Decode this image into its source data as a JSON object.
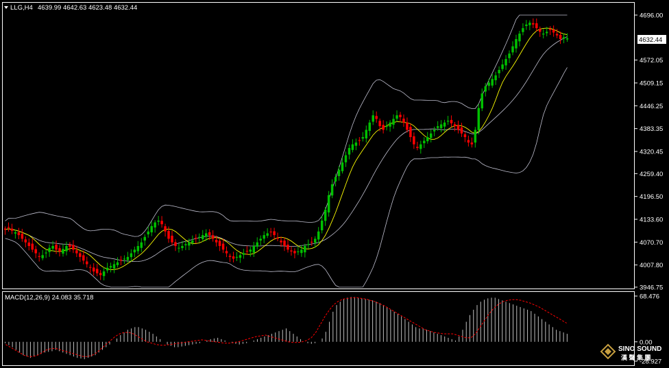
{
  "window": {
    "symbol_line": "LLG,H4",
    "ohlc_line": "4639.99 4642.63 4623.48 4632.44"
  },
  "indicator": {
    "macd_line": "MACD(12,26,9) 24.083 35.718"
  },
  "current_price_label": "4632.44",
  "watermark": {
    "brand": "SINO SOUND",
    "cjk": "漢 聲 集 團"
  },
  "colors": {
    "background": "#000000",
    "bull": "#00c000",
    "bear": "#ff0000",
    "band": "#c0c0d0",
    "ma": "#ffff00",
    "macd_hist": "#c0c0c0",
    "macd_signal": "#ff0000",
    "axis": "#ffffff",
    "gold": "#c8a040"
  },
  "chart_data": [
    {
      "type": "candlestick",
      "name_printed": "LLG,H4",
      "y_ticks": [
        "4696.00",
        "4632.44",
        "4572.05",
        "4509.15",
        "4446.25",
        "4383.35",
        "4320.45",
        "4259.40",
        "4196.50",
        "4133.60",
        "4070.70",
        "4007.80",
        "3946.75"
      ],
      "ylim": [
        3946.75,
        4696.0
      ],
      "overlays": [
        "bollinger-upper",
        "bollinger-middle",
        "bollinger-lower",
        "moving-average"
      ],
      "closes": [
        4105,
        4110,
        4102,
        4098,
        4090,
        4080,
        4070,
        4060,
        4050,
        4040,
        4030,
        4035,
        4042,
        4055,
        4060,
        4050,
        4045,
        4052,
        4060,
        4058,
        4050,
        4040,
        4030,
        4020,
        4010,
        4000,
        3990,
        3985,
        3980,
        3990,
        4000,
        4005,
        4010,
        4015,
        4020,
        4025,
        4030,
        4040,
        4050,
        4060,
        4070,
        4085,
        4100,
        4115,
        4125,
        4130,
        4120,
        4100,
        4080,
        4070,
        4060,
        4055,
        4060,
        4065,
        4070,
        4075,
        4080,
        4085,
        4090,
        4095,
        4090,
        4080,
        4070,
        4060,
        4050,
        4040,
        4030,
        4025,
        4030,
        4035,
        4040,
        4045,
        4050,
        4060,
        4070,
        4080,
        4090,
        4095,
        4098,
        4090,
        4080,
        4070,
        4060,
        4050,
        4045,
        4040,
        4045,
        4050,
        4060,
        4065,
        4070,
        4080,
        4100,
        4130,
        4160,
        4200,
        4230,
        4250,
        4270,
        4290,
        4310,
        4330,
        4340,
        4345,
        4350,
        4360,
        4380,
        4400,
        4420,
        4410,
        4390,
        4380,
        4390,
        4400,
        4410,
        4420,
        4415,
        4400,
        4380,
        4360,
        4340,
        4330,
        4340,
        4350,
        4360,
        4370,
        4380,
        4390,
        4395,
        4400,
        4405,
        4398,
        4390,
        4380,
        4370,
        4360,
        4345,
        4340,
        4380,
        4440,
        4480,
        4500,
        4510,
        4520,
        4530,
        4545,
        4560,
        4575,
        4590,
        4610,
        4630,
        4645,
        4660,
        4670,
        4675,
        4670,
        4660,
        4650,
        4645,
        4650,
        4655,
        4648,
        4640,
        4630,
        4635,
        4632
      ],
      "macd": {
        "ylim": [
          -28.927,
          68.476
        ],
        "y_ticks": [
          "68.476",
          "0.00",
          "-28.927"
        ],
        "histogram": [
          -2,
          -5,
          -8,
          -12,
          -16,
          -20,
          -22,
          -24,
          -22,
          -20,
          -18,
          -16,
          -15,
          -14,
          -12,
          -14,
          -16,
          -18,
          -20,
          -22,
          -24,
          -25,
          -26,
          -24,
          -22,
          -20,
          -16,
          -12,
          -8,
          -4,
          0,
          5,
          10,
          14,
          18,
          20,
          22,
          22,
          20,
          18,
          15,
          12,
          8,
          4,
          0,
          -4,
          -6,
          -8,
          -8,
          -7,
          -6,
          -5,
          -4,
          -3,
          -2,
          0,
          2,
          4,
          5,
          6,
          4,
          2,
          0,
          -2,
          -3,
          -4,
          -3,
          -2,
          0,
          2,
          4,
          6,
          8,
          10,
          12,
          14,
          16,
          18,
          20,
          16,
          12,
          8,
          4,
          0,
          -2,
          -3,
          -2,
          0,
          5,
          15,
          30,
          45,
          55,
          60,
          64,
          66,
          67,
          67,
          66,
          65,
          64,
          63,
          62,
          60,
          58,
          55,
          52,
          48,
          45,
          42,
          38,
          34,
          30,
          26,
          22,
          20,
          20,
          18,
          16,
          14,
          12,
          10,
          8,
          6,
          4,
          2,
          8,
          18,
          30,
          40,
          48,
          55,
          60,
          63,
          65,
          66,
          66,
          64,
          62,
          60,
          58,
          56,
          54,
          52,
          50,
          48,
          46,
          42,
          38,
          34,
          30,
          26,
          22,
          18,
          16,
          14,
          12
        ],
        "signal_approx": [
          -4,
          -8,
          -12,
          -16,
          -20,
          -22,
          -22,
          -20,
          -16,
          -12,
          -10,
          -10,
          -12,
          -14,
          -16,
          -18,
          -20,
          -22,
          -22,
          -20,
          -16,
          -10,
          -4,
          2,
          8,
          12,
          14,
          14,
          12,
          8,
          4,
          0,
          -2,
          -4,
          -5,
          -5,
          -4,
          -3,
          -2,
          -1,
          0,
          1,
          2,
          3,
          2,
          1,
          0,
          -1,
          -2,
          -2,
          -1,
          0,
          2,
          4,
          6,
          8,
          9,
          10,
          8,
          6,
          4,
          2,
          0,
          -1,
          -1,
          0,
          2,
          6,
          14,
          26,
          38,
          48,
          56,
          61,
          64,
          65,
          66,
          66,
          65,
          64,
          62,
          60,
          57,
          54,
          50,
          46,
          42,
          38,
          34,
          30,
          26,
          22,
          18,
          16,
          14,
          13,
          12,
          12,
          12,
          10,
          8,
          6,
          6,
          12,
          22,
          32,
          42,
          50,
          56,
          60,
          62,
          63,
          63,
          62,
          60,
          58,
          55,
          52,
          48,
          44,
          40,
          36,
          32,
          28
        ]
      }
    }
  ]
}
